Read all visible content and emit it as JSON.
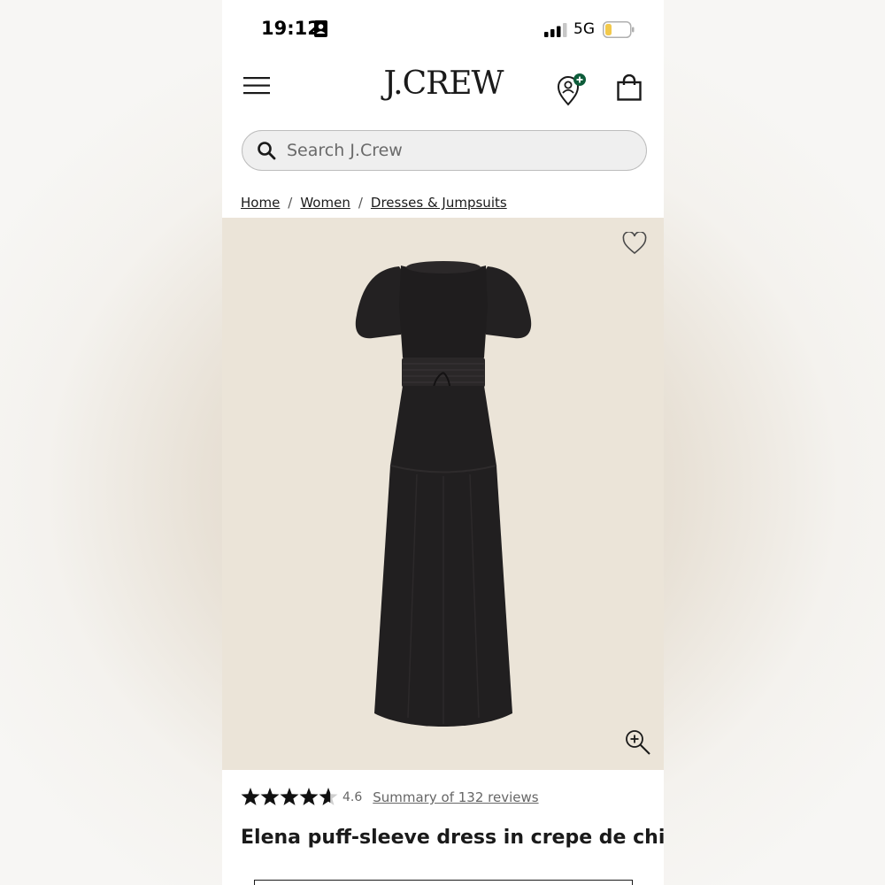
{
  "status_bar": {
    "time": "19:12",
    "network": "5G",
    "icons": [
      "person-card-icon",
      "signal-bars-icon",
      "battery-low-icon"
    ],
    "battery_color": "#f2c94c"
  },
  "header": {
    "logo": "J.CREW",
    "icons": [
      "hamburger-menu-icon",
      "account-location-icon",
      "shopping-bag-icon"
    ],
    "account_badge_color": "#0d5c3a"
  },
  "search": {
    "placeholder": "Search J.Crew"
  },
  "breadcrumb": {
    "items": [
      "Home",
      "Women",
      "Dresses & Jumpsuits"
    ],
    "separator": "/"
  },
  "product": {
    "image_alt_icon": "dress-image",
    "image_background": "#ebe4d8",
    "rating_value": "4.6",
    "rating_stars": 4.6,
    "rating_max": 5,
    "reviews_link": "Summary of 132 reviews",
    "title": "Elena puff-sleeve dress in crepe de chine"
  },
  "colors": {
    "text": "#1a1a1a",
    "muted": "#666666"
  }
}
